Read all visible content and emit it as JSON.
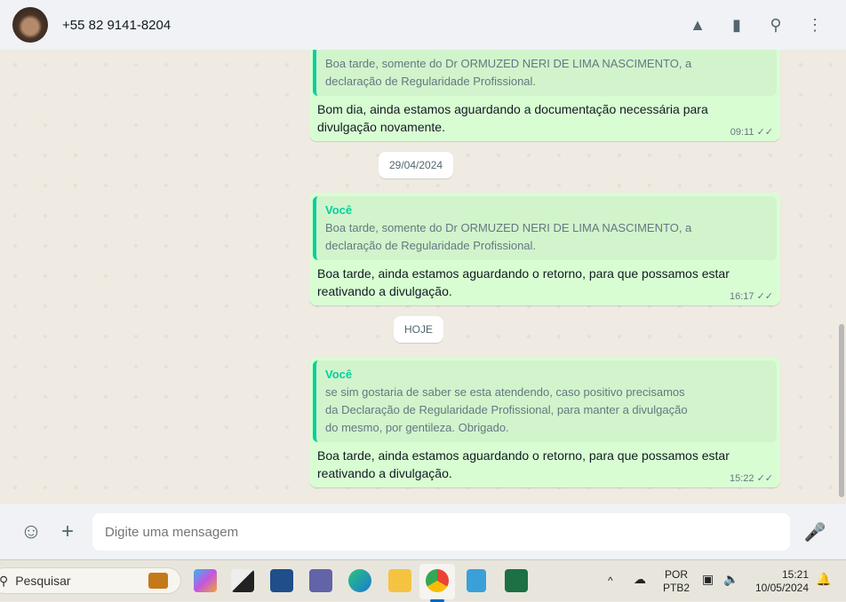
{
  "header": {
    "contact": "+55 82 9141-8204",
    "icons": [
      "archive-icon",
      "label-icon",
      "search-icon",
      "menu-icon"
    ]
  },
  "messages": [
    {
      "quote_author": "",
      "quote_text": "Boa tarde, somente do Dr ORMUZED NERI DE LIMA NASCIMENTO, a declaração de Regularidade Profissional.",
      "text": "Bom dia, ainda estamos aguardando a documentação necessária para divulgação novamente.",
      "time": "09:11"
    },
    {
      "quote_author": "Você",
      "quote_text": "Boa tarde, somente do Dr ORMUZED NERI DE LIMA NASCIMENTO, a declaração de Regularidade Profissional.",
      "text": "Boa tarde, ainda estamos aguardando o retorno, para que possamos estar reativando a divulgação.",
      "time": "16:17"
    },
    {
      "quote_author": "Você",
      "quote_text": "se sim gostaria de saber se esta atendendo, caso positivo precisamos da Declaração de Regularidade Profissional, para manter a divulgação do mesmo, por gentileza. Obrigado.",
      "text": "Boa tarde, ainda estamos aguardando o retorno, para que possamos estar reativando a divulgação.",
      "time": "15:22"
    }
  ],
  "dates": [
    "29/04/2024",
    "HOJE"
  ],
  "composer": {
    "placeholder": "Digite uma mensagem"
  },
  "taskbar": {
    "search": "Pesquisar",
    "lang1": "POR",
    "lang2": "PTB2",
    "time": "15:21",
    "date": "10/05/2024"
  }
}
